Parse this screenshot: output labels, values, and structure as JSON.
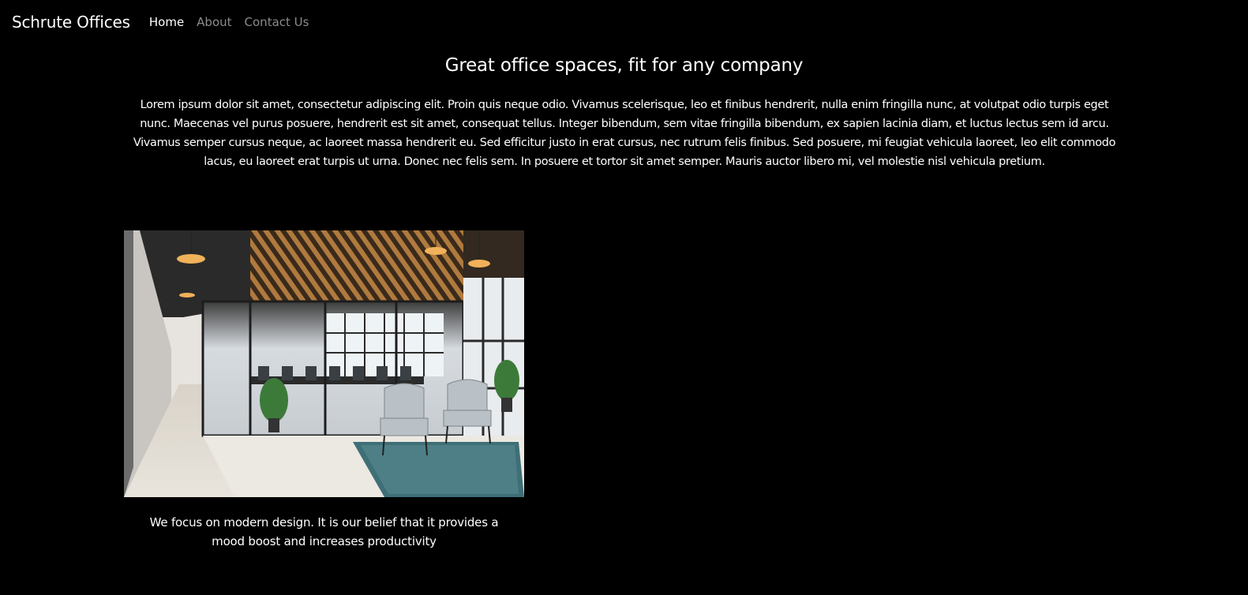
{
  "navbar": {
    "brand": "Schrute Offices",
    "links": [
      {
        "label": "Home",
        "active": true
      },
      {
        "label": "About",
        "active": false
      },
      {
        "label": "Contact Us",
        "active": false
      }
    ]
  },
  "hero": {
    "title": "Great office spaces, fit for any company",
    "intro": "Lorem ipsum dolor sit amet, consectetur adipiscing elit. Proin quis neque odio. Vivamus scelerisque, leo et finibus hendrerit, nulla enim fringilla nunc, at volutpat odio turpis eget nunc. Maecenas vel purus posuere, hendrerit est sit amet, consequat tellus. Integer bibendum, sem vitae fringilla bibendum, ex sapien lacinia diam, et luctus lectus sem id arcu. Vivamus semper cursus neque, ac laoreet massa hendrerit eu. Sed efficitur justo in erat cursus, nec rutrum felis finibus. Sed posuere, mi feugiat vehicula laoreet, leo elit commodo lacus, eu laoreet erat turpis ut urna. Donec nec felis sem. In posuere et tortor sit amet semper. Mauris auctor libero mi, vel molestie nisl vehicula pretium."
  },
  "feature": {
    "image_icon": "office-photo",
    "caption": "We focus on modern design. It is our belief that it provides a mood boost and increases productivity"
  },
  "colors": {
    "background": "#000000",
    "text": "#ffffff",
    "nav_muted": "#8c8c8c"
  }
}
